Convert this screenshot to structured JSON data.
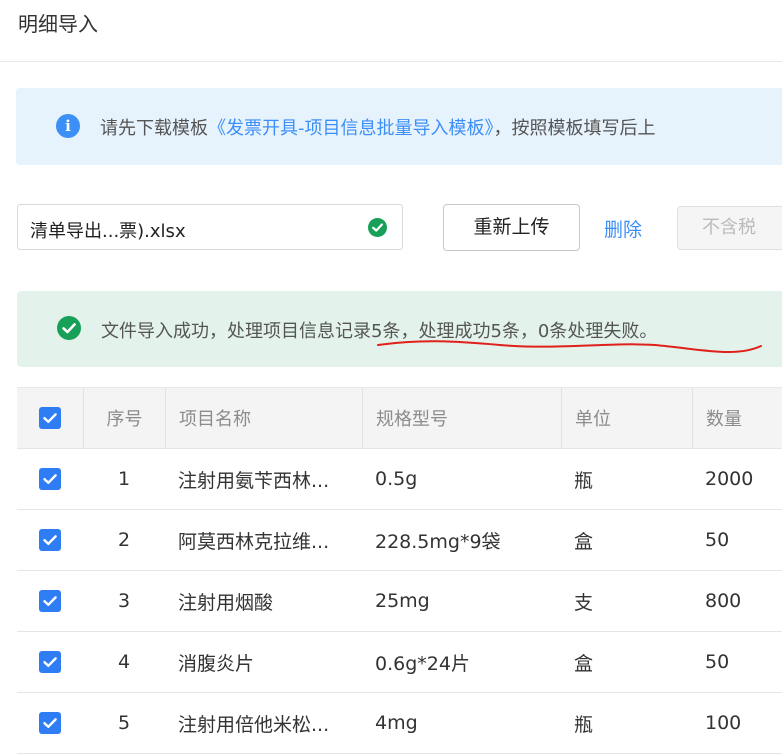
{
  "header": {
    "title": "明细导入"
  },
  "info_banner": {
    "prefix": "请先下载模板",
    "link": "《发票开具-项目信息批量导入模板》",
    "suffix": "，按照模板填写后上"
  },
  "upload": {
    "file_name": "清单导出...票).xlsx",
    "reupload_label": "重新上传",
    "delete_label": "删除",
    "notax_label": "不含税"
  },
  "success_banner": {
    "text": "文件导入成功，处理项目信息记录5条，处理成功5条，0条处理失败。",
    "annotation_color": "#e0201a"
  },
  "table": {
    "headers": {
      "index": "序号",
      "name": "项目名称",
      "spec": "规格型号",
      "unit": "单位",
      "qty": "数量"
    },
    "rows": [
      {
        "checked": true,
        "index": "1",
        "name": "注射用氨苄西林...",
        "spec": "0.5g",
        "unit": "瓶",
        "qty": "2000"
      },
      {
        "checked": true,
        "index": "2",
        "name": "阿莫西林克拉维...",
        "spec": "228.5mg*9袋",
        "unit": "盒",
        "qty": "50"
      },
      {
        "checked": true,
        "index": "3",
        "name": "注射用烟酸",
        "spec": "25mg",
        "unit": "支",
        "qty": "800"
      },
      {
        "checked": true,
        "index": "4",
        "name": "消腹炎片",
        "spec": "0.6g*24片",
        "unit": "盒",
        "qty": "50"
      },
      {
        "checked": true,
        "index": "5",
        "name": "注射用倍他米松...",
        "spec": "4mg",
        "unit": "瓶",
        "qty": "100"
      }
    ]
  },
  "colors": {
    "accent": "#3c8ff7",
    "checkbox": "#2f7df5",
    "success": "#18a058",
    "info_bg": "#e6f2fc",
    "success_bg": "#e3f3eb"
  }
}
